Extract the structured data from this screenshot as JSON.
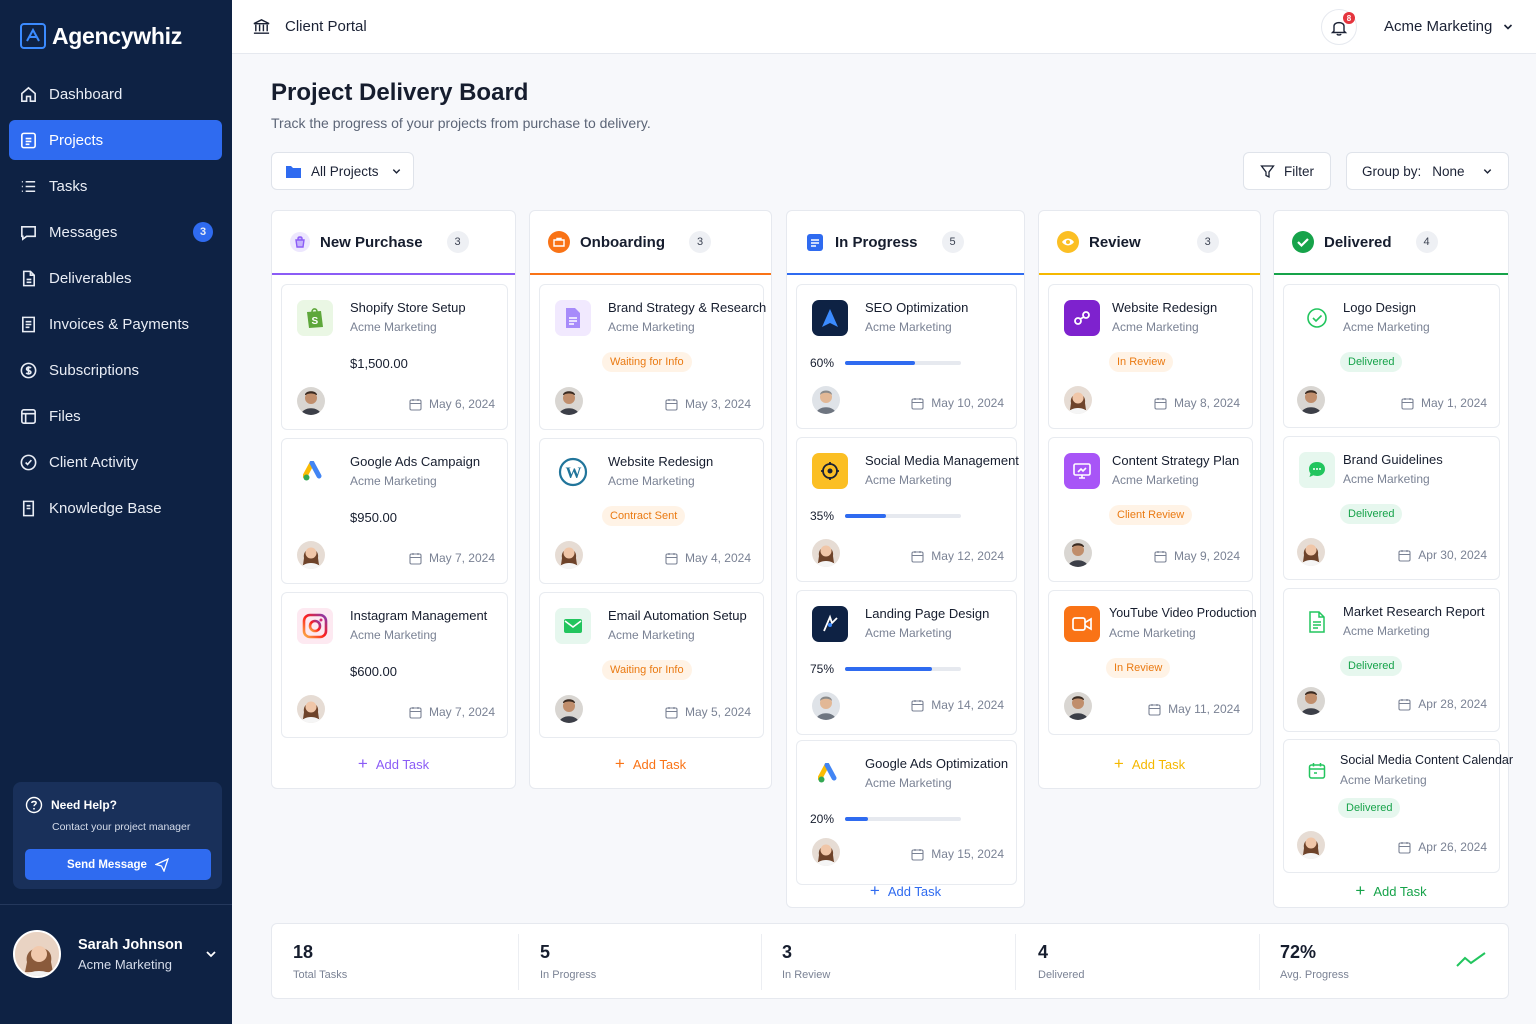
{
  "app": {
    "name": "Agencywhiz"
  },
  "sidebar": {
    "items": [
      {
        "label": "Dashboard",
        "icon": "home-icon"
      },
      {
        "label": "Projects",
        "icon": "projects-icon",
        "active": true
      },
      {
        "label": "Tasks",
        "icon": "list-icon"
      },
      {
        "label": "Messages",
        "icon": "message-icon",
        "badge": "3"
      },
      {
        "label": "Deliverables",
        "icon": "file-icon"
      },
      {
        "label": "Invoices & Payments",
        "icon": "invoice-icon"
      },
      {
        "label": "Subscriptions",
        "icon": "dollar-icon"
      },
      {
        "label": "Files",
        "icon": "folder-icon"
      },
      {
        "label": "Client Activity",
        "icon": "activity-icon"
      },
      {
        "label": "Knowledge Base",
        "icon": "book-icon"
      }
    ],
    "help": {
      "title": "Need Help?",
      "subtitle": "Contact your project manager",
      "button": "Send Message"
    },
    "user": {
      "name": "Sarah Johnson",
      "org": "Acme Marketing"
    }
  },
  "topbar": {
    "title": "Client Portal",
    "notifications": "8",
    "account": "Acme Marketing"
  },
  "page": {
    "title": "Project Delivery Board",
    "subtitle": "Track the progress of your projects from purchase to delivery.",
    "filter_projects": "All Projects",
    "filter_label": "Filter",
    "group_by_label": "Group by:",
    "group_by_value": "None"
  },
  "add_task_label": "Add Task",
  "columns": [
    {
      "title": "New Purchase",
      "count": "3",
      "color": "#8b5cf6",
      "cards": [
        {
          "title": "Shopify Store Setup",
          "client": "Acme Marketing",
          "price": "$1,500.00",
          "date": "May 6, 2024",
          "icon": "shopify-icon"
        },
        {
          "title": "Google Ads Campaign",
          "client": "Acme Marketing",
          "price": "$950.00",
          "date": "May 7, 2024",
          "icon": "google-ads-icon"
        },
        {
          "title": "Instagram Management",
          "client": "Acme Marketing",
          "price": "$600.00",
          "date": "May 7, 2024",
          "icon": "instagram-icon"
        }
      ]
    },
    {
      "title": "Onboarding",
      "count": "3",
      "color": "#f97316",
      "cards": [
        {
          "title": "Brand Strategy & Research",
          "client": "Acme Marketing",
          "status": "Waiting for Info",
          "date": "May 3, 2024",
          "icon": "document-icon"
        },
        {
          "title": "Website Redesign",
          "client": "Acme Marketing",
          "status": "Contract Sent",
          "date": "May 4, 2024",
          "icon": "wordpress-icon"
        },
        {
          "title": "Email Automation Setup",
          "client": "Acme Marketing",
          "status": "Waiting for Info",
          "date": "May 5, 2024",
          "icon": "email-icon"
        }
      ]
    },
    {
      "title": "In Progress",
      "count": "5",
      "color": "#2f6bf0",
      "cards": [
        {
          "title": "SEO Optimization",
          "client": "Acme Marketing",
          "progress": 60,
          "progress_label": "60%",
          "date": "May 10, 2024",
          "icon": "seo-icon"
        },
        {
          "title": "Social Media Management",
          "client": "Acme Marketing",
          "progress": 35,
          "progress_label": "35%",
          "date": "May 12, 2024",
          "icon": "social-icon"
        },
        {
          "title": "Landing Page Design",
          "client": "Acme Marketing",
          "progress": 75,
          "progress_label": "75%",
          "date": "May 14, 2024",
          "icon": "design-icon"
        },
        {
          "title": "Google Ads Optimization",
          "client": "Acme Marketing",
          "progress": 20,
          "progress_label": "20%",
          "date": "May 15, 2024",
          "icon": "google-ads-icon"
        }
      ]
    },
    {
      "title": "Review",
      "count": "3",
      "color": "#f5b800",
      "cards": [
        {
          "title": "Website Redesign",
          "client": "Acme Marketing",
          "status": "In Review",
          "date": "May 8, 2024",
          "icon": "link-icon"
        },
        {
          "title": "Content Strategy Plan",
          "client": "Acme Marketing",
          "status": "Client Review",
          "date": "May 9, 2024",
          "icon": "presentation-icon"
        },
        {
          "title": "YouTube Video Production",
          "client": "Acme Marketing",
          "status": "In Review",
          "date": "May 11, 2024",
          "icon": "video-icon"
        }
      ]
    },
    {
      "title": "Delivered",
      "count": "4",
      "color": "#16a34a",
      "cards": [
        {
          "title": "Logo Design",
          "client": "Acme Marketing",
          "status": "Delivered",
          "date": "May 1, 2024",
          "icon": "check-circle-icon"
        },
        {
          "title": "Brand Guidelines",
          "client": "Acme Marketing",
          "status": "Delivered",
          "date": "Apr 30, 2024",
          "icon": "chat-icon"
        },
        {
          "title": "Market Research Report",
          "client": "Acme Marketing",
          "status": "Delivered",
          "date": "Apr 28, 2024",
          "icon": "report-icon"
        },
        {
          "title": "Social Media Content Calendar",
          "client": "Acme Marketing",
          "status": "Delivered",
          "date": "Apr 26, 2024",
          "icon": "calendar-icon"
        }
      ]
    }
  ],
  "stats": [
    {
      "value": "18",
      "label": "Total Tasks"
    },
    {
      "value": "5",
      "label": "In Progress"
    },
    {
      "value": "3",
      "label": "In Review"
    },
    {
      "value": "4",
      "label": "Delivered"
    },
    {
      "value": "72%",
      "label": "Avg. Progress"
    }
  ]
}
